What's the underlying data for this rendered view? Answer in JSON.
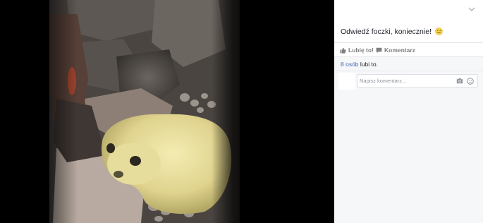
{
  "photo": {
    "subject": "seal-pup-on-rocks"
  },
  "post": {
    "caption": "Odwiedź foczki, koniecznie!",
    "emoji_icon": "slightly-smiling-face-icon"
  },
  "actions": {
    "like_label": "Lubię to!",
    "comment_label": "Komentarz"
  },
  "feedback": {
    "likes_count": "8 osób",
    "likes_suffix": " lubi to."
  },
  "comment": {
    "placeholder": "Napisz komentarz..."
  },
  "icons": {
    "options": "chevron-down-icon",
    "like": "thumbs-up-icon",
    "comment": "speech-bubble-icon",
    "camera": "camera-icon",
    "emoji": "emoji-icon"
  },
  "colors": {
    "link": "#4267b2",
    "muted": "#7f7f7f",
    "feedback_bg": "#f6f7f9"
  }
}
